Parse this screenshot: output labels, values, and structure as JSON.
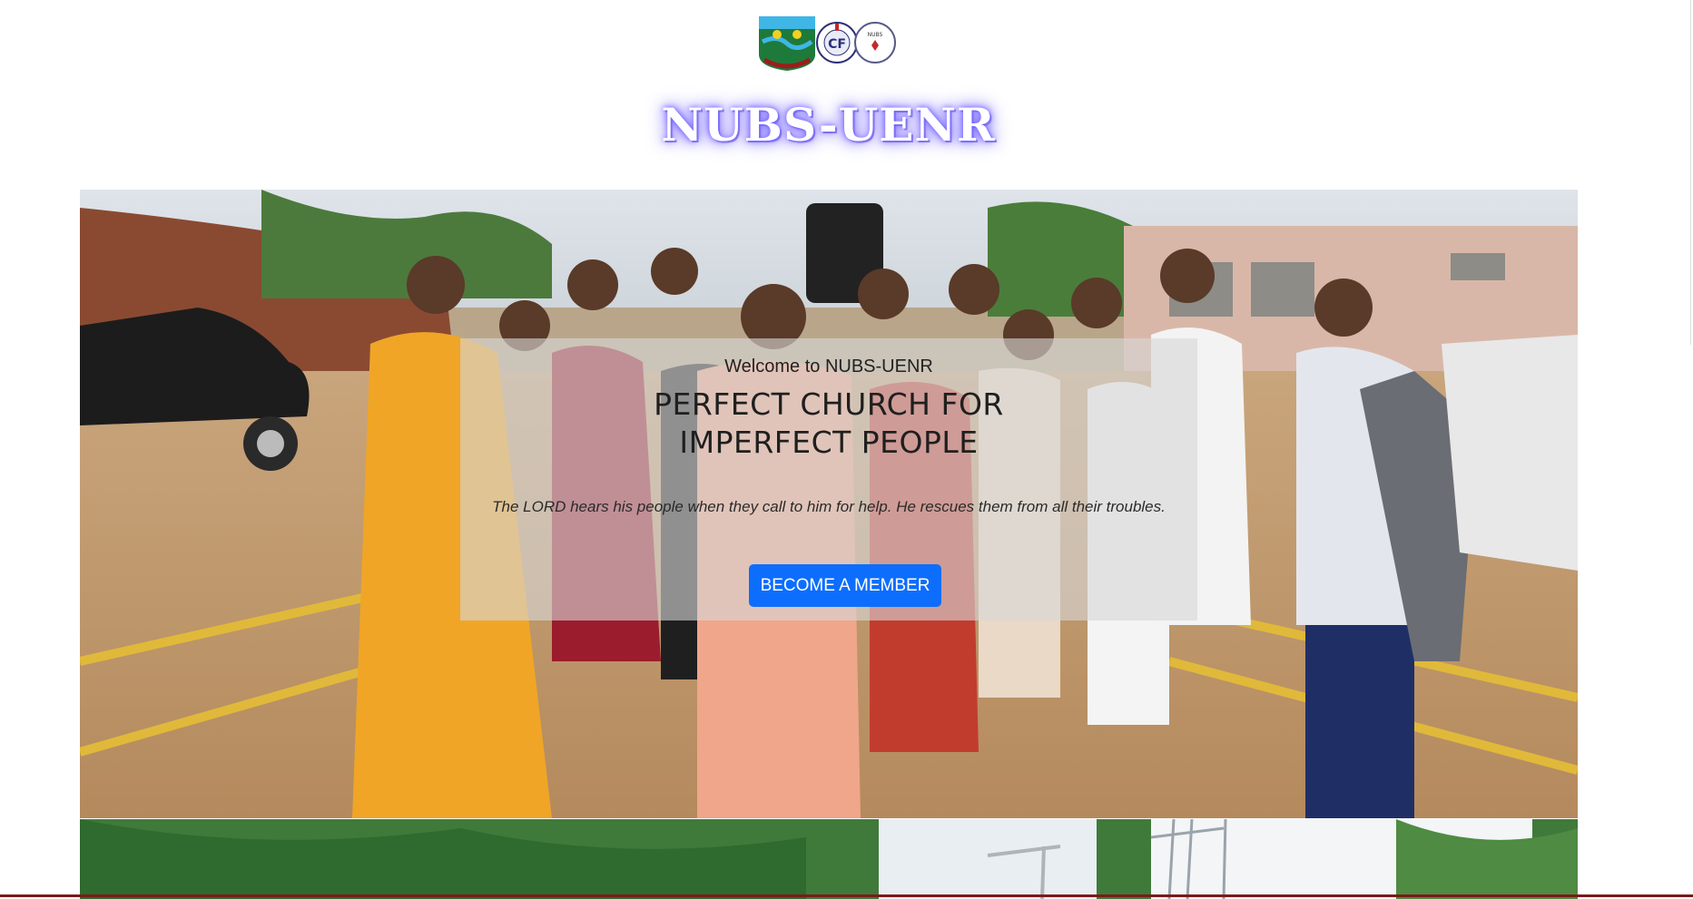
{
  "header": {
    "logos": [
      {
        "icon": "uenr-crest-logo"
      },
      {
        "icon": "cf-emblem-logo"
      },
      {
        "icon": "nubs-emblem-logo",
        "text": "NUBS"
      }
    ],
    "site_title": "NUBS-UENR",
    "title_glow_color": "#7b6cff"
  },
  "hero": {
    "welcome": "Welcome to NUBS-UENR",
    "headline_line1": "PERFECT CHURCH FOR",
    "headline_line2": "IMPERFECT PEOPLE",
    "verse": "The LORD hears his people when they call to him for help. He rescues them from all their troubles.",
    "cta_label": "BECOME A MEMBER",
    "cta_color": "#0d6efd"
  }
}
